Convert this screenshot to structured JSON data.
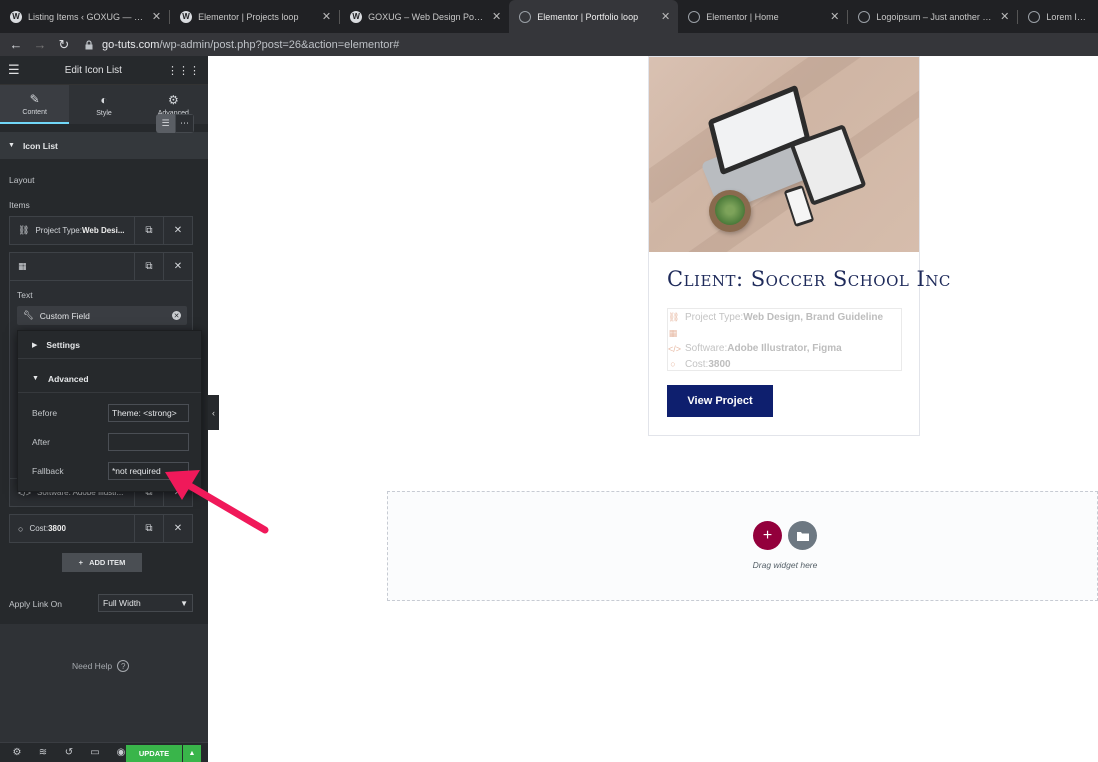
{
  "browser": {
    "tabs": [
      {
        "title": "Listing Items ‹ GOXUG — Word",
        "icon": "wordpress-icon",
        "active": false
      },
      {
        "title": "Elementor | Projects loop",
        "icon": "wordpress-icon",
        "active": false
      },
      {
        "title": "GOXUG – Web Design Portfolio",
        "icon": "wordpress-icon",
        "active": false
      },
      {
        "title": "Elementor | Portfolio loop",
        "icon": "globe-icon",
        "active": true
      },
      {
        "title": "Elementor | Home",
        "icon": "globe-icon",
        "active": false
      },
      {
        "title": "Logoipsum – Just another Wor",
        "icon": "globe-icon",
        "active": false
      },
      {
        "title": "Lorem Ipsum",
        "icon": "globe-icon",
        "active": false
      }
    ],
    "url_domain": "go-tuts.com",
    "url_path": "/wp-admin/post.php?post=26&action=elementor#"
  },
  "panel": {
    "title": "Edit Icon List",
    "tabs": [
      {
        "label": "Content",
        "icon": "pencil-icon"
      },
      {
        "label": "Style",
        "icon": "half-circle-icon"
      },
      {
        "label": "Advanced",
        "icon": "gear-icon"
      }
    ],
    "section_title": "Icon List",
    "layout_label": "Layout",
    "items_label": "Items",
    "item1_prefix": "Project Type: ",
    "item1_bold": "Web Desi...",
    "text_label": "Text",
    "custom_field_label": "Custom Field",
    "popover": {
      "settings_label": "Settings",
      "advanced_label": "Advanced",
      "before_label": "Before",
      "before_value": "Theme: <strong>",
      "after_label": "After",
      "after_value": "",
      "fallback_label": "Fallback",
      "fallback_value": "*not required"
    },
    "item3_label": "Software: Adobe Illustr...",
    "item4_prefix": "Cost: ",
    "item4_bold": "3800",
    "add_item_label": "ADD ITEM",
    "apply_link_label": "Apply Link On",
    "apply_link_value": "Full Width",
    "need_help_label": "Need Help",
    "update_label": "UPDATE"
  },
  "preview": {
    "card_title": "Client: Soccer School Inc",
    "meta": [
      {
        "icon": "sitemap-icon",
        "prefix": "Project Type: ",
        "bold": "Web Design, Brand Guideline"
      },
      {
        "icon": "qr-icon",
        "prefix": "",
        "bold": ""
      },
      {
        "icon": "code-icon",
        "prefix": "Software: ",
        "bold": "Adobe Illustrator, Figma"
      },
      {
        "icon": "circle-icon",
        "prefix": "Cost: ",
        "bold": "3800"
      }
    ],
    "button_label": "View Project",
    "drop_text": "Drag widget here"
  },
  "colors": {
    "panel_bg": "#26292c",
    "update_green": "#39b54a",
    "title_navy": "#1e2a5a",
    "button_navy": "#0e1f6e",
    "add_maroon": "#93003c",
    "arrow_pink": "#f0195a",
    "tab_accent": "#71d7f7"
  }
}
